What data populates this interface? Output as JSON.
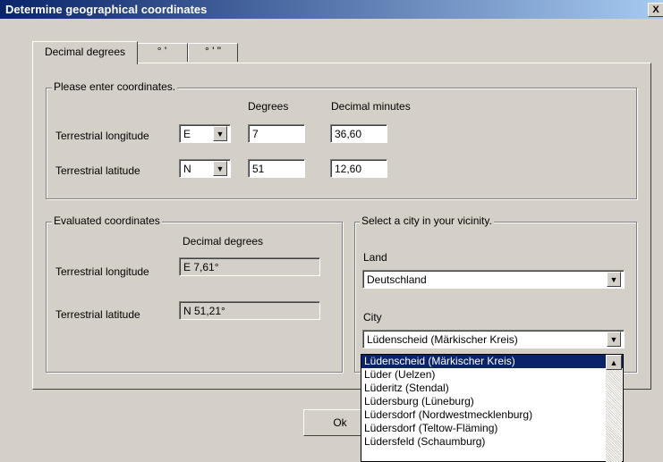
{
  "window": {
    "title": "Determine geographical coordinates",
    "close_label": "X"
  },
  "tabs": [
    {
      "label": "Decimal degrees"
    },
    {
      "label": "° '"
    },
    {
      "label": "° ' \""
    }
  ],
  "input_group": {
    "legend": "Please enter coordinates.",
    "col_degrees": "Degrees",
    "col_minutes": "Decimal minutes",
    "longitude": {
      "label": "Terrestrial longitude",
      "hemisphere": "E",
      "degrees": "7",
      "minutes": "36,60"
    },
    "latitude": {
      "label": "Terrestrial latitude",
      "hemisphere": "N",
      "degrees": "51",
      "minutes": "12,60"
    }
  },
  "evaluated_group": {
    "legend": "Evaluated coordinates",
    "col_label": "Decimal degrees",
    "longitude": {
      "label": "Terrestrial longitude",
      "value": "E 7,61°"
    },
    "latitude": {
      "label": "Terrestrial latitude",
      "value": "N 51,21°"
    }
  },
  "city_group": {
    "legend": "Select a city in your vicinity.",
    "land_label": "Land",
    "land_value": "Deutschland",
    "city_label": "City",
    "city_value": "Lüdenscheid (Märkischer Kreis)",
    "city_options": [
      "Lüdenscheid (Märkischer Kreis)",
      "Lüder (Uelzen)",
      "Lüderitz (Stendal)",
      "Lüdersburg (Lüneburg)",
      "Lüdersdorf (Nordwestmecklenburg)",
      "Lüdersdorf (Teltow-Fläming)",
      "Lüdersfeld (Schaumburg)"
    ]
  },
  "buttons": {
    "ok": "Ok"
  },
  "icons": {
    "dropdown": "chevron-down-icon",
    "scroll_up": "arrow-up-icon"
  },
  "colors": {
    "titlebar_start": "#0a246a",
    "titlebar_end": "#a6caf0",
    "selection": "#0a246a",
    "face": "#d4d0c8"
  }
}
